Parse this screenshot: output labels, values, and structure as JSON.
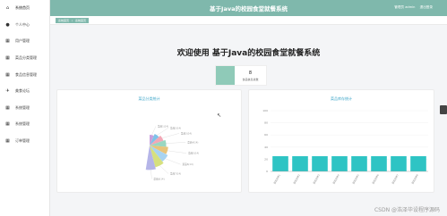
{
  "app": {
    "title": "基于Java的校园食堂就餐系统"
  },
  "header": {
    "user_label": "管理员 admin",
    "logout": "退出登录"
  },
  "sidebar": {
    "items": [
      {
        "label": "系统首页",
        "icon": "home-icon"
      },
      {
        "label": "个人中心",
        "icon": "person-icon"
      },
      {
        "label": "用户管理",
        "icon": "grid-icon"
      },
      {
        "label": "菜品分类管理",
        "icon": "grid-icon"
      },
      {
        "label": "食品信息管理",
        "icon": "grid-icon"
      },
      {
        "label": "美食论坛",
        "icon": "pin-icon"
      },
      {
        "label": "系统管理",
        "icon": "grid-icon"
      },
      {
        "label": "系统管理",
        "icon": "grid-icon"
      },
      {
        "label": "订单管理",
        "icon": "grid-icon"
      }
    ]
  },
  "breadcrumb": {
    "home": "系统首页",
    "current": "系统首页"
  },
  "main": {
    "welcome": "欢迎使用 基于Java的校园食堂就餐系统",
    "stat": {
      "value": "8",
      "label": "食品信息总数"
    },
    "left_panel_title": "菜品分类统计",
    "right_panel_title": "菜品库存统计"
  },
  "chart_data": [
    {
      "type": "pie",
      "title": "菜品分类统计",
      "labels": [
        "菜品1(14)",
        "菜品2(14)",
        "菜品3(14)",
        "菜品4(14)",
        "菜品5(14)",
        "菜品6(14)",
        "菜品7(14)",
        "菜品8(14)"
      ],
      "values": [
        14,
        14,
        14,
        14,
        14,
        14,
        14,
        14
      ],
      "colors": [
        "#c9a0dc",
        "#7ec1e8",
        "#f2a7b6",
        "#9ad7c1",
        "#e8c47a",
        "#a8d3f0",
        "#d6e07e",
        "#b5b5e8"
      ]
    },
    {
      "type": "bar",
      "title": "菜品库存统计",
      "categories": [
        "菜品名称1",
        "菜品名称2",
        "菜品名称3",
        "菜品名称4",
        "菜品名称5",
        "菜品名称6",
        "菜品名称7",
        "菜品名称8"
      ],
      "values": [
        25,
        25,
        25,
        25,
        25,
        25,
        25,
        25
      ],
      "ylim": [
        0,
        100
      ],
      "yticks": [
        0,
        20,
        40,
        60,
        80,
        100
      ],
      "color": "#2ec4c4"
    }
  ],
  "watermark": "CSDN @浩泽毕设程序源码"
}
